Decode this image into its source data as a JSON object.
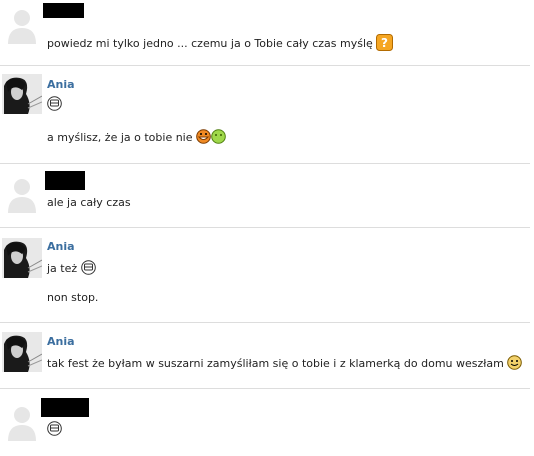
{
  "colors": {
    "name": "#3b6e9f",
    "divider": "#dddddd",
    "text": "#222222",
    "redaction": "#000000"
  },
  "messages": [
    {
      "sender": "",
      "lines": [
        "powiedz mi tylko jedno ... czemu ja o Tobie cały czas myślę"
      ],
      "icons": [
        "question-emoticon-icon"
      ]
    },
    {
      "sender": "Ania",
      "lines": [
        "",
        "a myślisz, że ja o tobie nie"
      ],
      "icons": [
        "grin-emoticon-icon",
        "laughing-emoticon-icon"
      ]
    },
    {
      "sender": "",
      "lines": [
        "ale ja cały czas"
      ]
    },
    {
      "sender": "Ania",
      "lines": [
        "ja też",
        "non stop."
      ],
      "icons": [
        "grin-emoticon-icon"
      ]
    },
    {
      "sender": "Ania",
      "lines": [
        "tak fest że byłam w suszarni zamyśliłam się o tobie i z klamerką do domu weszłam"
      ],
      "icons": [
        "smile-emoticon-icon"
      ]
    },
    {
      "sender": "",
      "lines": [
        ""
      ],
      "icons": [
        "grin-emoticon-icon"
      ]
    }
  ]
}
